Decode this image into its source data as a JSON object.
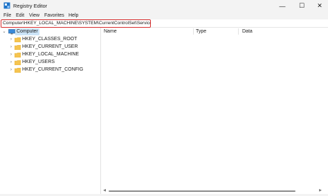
{
  "window": {
    "title": "Registry Editor",
    "minimize_glyph": "—",
    "maximize_glyph": "☐",
    "close_glyph": "✕"
  },
  "menu": {
    "items": [
      "File",
      "Edit",
      "View",
      "Favorites",
      "Help"
    ]
  },
  "address": {
    "value": "Computer\\HKEY_LOCAL_MACHINE\\SYSTEM\\CurrentControlSet\\Services",
    "highlight_color": "#d62b2b"
  },
  "tree": {
    "root": {
      "label": "Computer",
      "expanded": true,
      "selected": true
    },
    "children": [
      {
        "label": "HKEY_CLASSES_ROOT"
      },
      {
        "label": "HKEY_CURRENT_USER"
      },
      {
        "label": "HKEY_LOCAL_MACHINE"
      },
      {
        "label": "HKEY_USERS"
      },
      {
        "label": "HKEY_CURRENT_CONFIG"
      }
    ],
    "folder_color": "#f5c451"
  },
  "list": {
    "columns": [
      "Name",
      "Type",
      "Data"
    ]
  },
  "icons": {
    "app": "registry-editor-icon",
    "folder": "folder-icon",
    "computer": "computer-icon",
    "chevron_right": "chevron-right-icon",
    "chevron_down": "chevron-down-icon"
  }
}
